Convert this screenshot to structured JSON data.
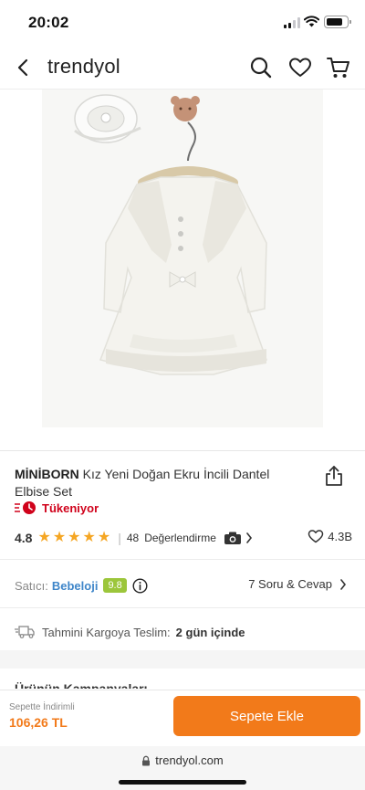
{
  "status": {
    "time": "20:02"
  },
  "nav": {
    "logo": "trendyol",
    "icons": [
      "chevron-left-icon",
      "search-icon",
      "heart-icon",
      "cart-icon"
    ]
  },
  "product": {
    "brand": "MİNİBORN",
    "name": "Kız Yeni Doğan Ekru İncili Dantel Elbise Set",
    "stock_status": "Tükeniyor",
    "rating_value": "4.8",
    "stars": 5,
    "review_count": "48",
    "reviews_label": "Değerlendirme",
    "favorite_count": "4.3B"
  },
  "seller": {
    "label": "Satıcı:",
    "name": "Bebeloji",
    "score": "9.8",
    "qa_link": "7 Soru & Cevap"
  },
  "delivery": {
    "label": "Tahmini Kargoya Teslim:",
    "value": "2 gün içinde"
  },
  "campaigns": {
    "title": "Ürünün Kampanyaları"
  },
  "cart": {
    "discount_label": "Sepette İndirimli",
    "price": "106,26 TL",
    "add_button": "Sepete Ekle"
  },
  "browser": {
    "url": "trendyol.com"
  },
  "colors": {
    "accent": "#f27a1a",
    "stock_red": "#d0021b",
    "star": "#f5a623",
    "seller_link": "#3f86c9",
    "seller_score": "#9cc63b"
  }
}
